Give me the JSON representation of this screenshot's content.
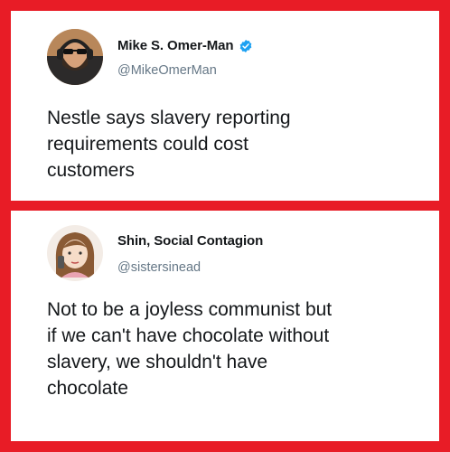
{
  "tweets": [
    {
      "author": "Mike S. Omer-Man",
      "handle": "@MikeOmerMan",
      "verified": true,
      "avatar_icon": "bearded-man-headphones-avatar",
      "text": "Nestle says slavery reporting\nrequirements could cost\ncustomers"
    },
    {
      "author": "Shin, Social Contagion",
      "handle": "@sistersinead",
      "verified": false,
      "avatar_icon": "cartoon-woman-phone-avatar",
      "text": "Not to be a joyless communist but\nif we can't have chocolate without\nslavery, we shouldn't have\nchocolate"
    }
  ],
  "colors": {
    "background": "#e81c26",
    "card": "#ffffff",
    "verified": "#1da1f2",
    "handle": "#657786",
    "text": "#14171a"
  }
}
